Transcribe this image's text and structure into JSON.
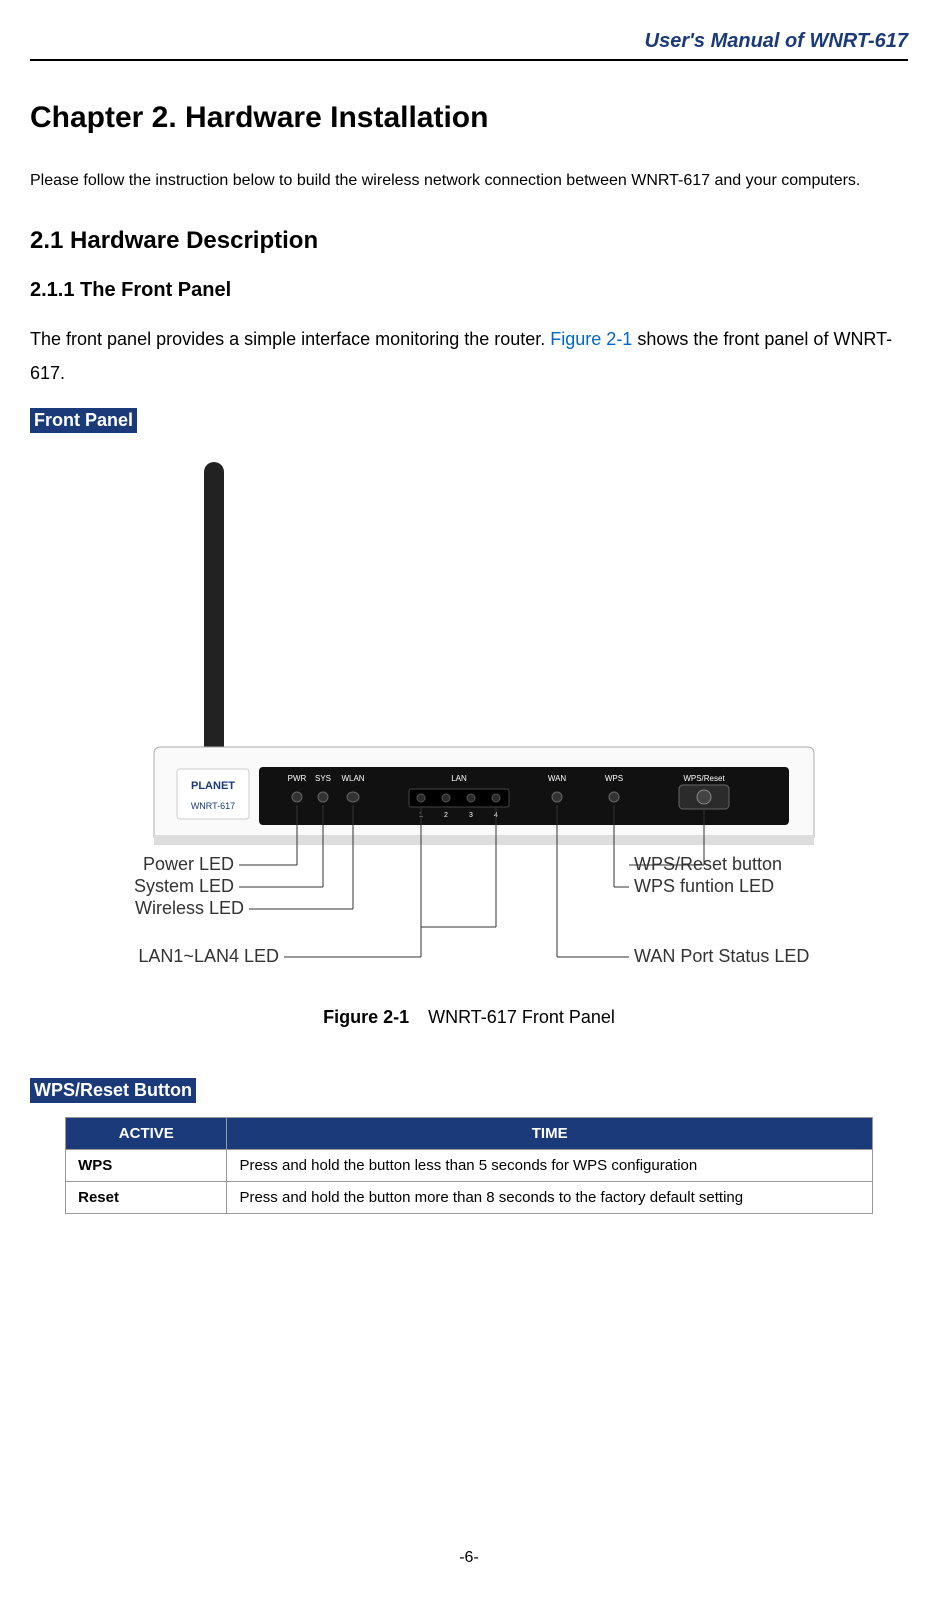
{
  "header": {
    "title": "User's Manual of WNRT-617"
  },
  "chapter": {
    "title": "Chapter 2.   Hardware Installation",
    "intro": "Please follow the instruction below to build the wireless network connection between WNRT-617 and your computers."
  },
  "section_2_1": {
    "title": "2.1  Hardware Description"
  },
  "section_2_1_1": {
    "title": "2.1.1  The Front Panel",
    "para_prefix": "The front panel provides a simple interface monitoring the router. ",
    "figure_ref": "Figure 2-1",
    "para_suffix": " shows the front panel of WNRT-617.",
    "front_panel_label": "Front Panel"
  },
  "figure": {
    "labels": {
      "power_led": "Power LED",
      "system_led": "System LED",
      "wireless_led": "Wireless LED",
      "lan_led": "LAN1~LAN4 LED",
      "wps_reset_btn": "WPS/Reset button",
      "wps_led": "WPS funtion LED",
      "wan_led": "WAN Port Status LED"
    },
    "device": {
      "brand": "PLANET",
      "model": "WNRT-617",
      "panel_labels": {
        "pwr": "PWR",
        "sys": "SYS",
        "wlan": "WLAN",
        "lan": "LAN",
        "wan": "WAN",
        "wps": "WPS",
        "wps_reset": "WPS/Reset",
        "lan1": "1",
        "lan2": "2",
        "lan3": "3",
        "lan4": "4"
      }
    },
    "caption_label": "Figure 2-1",
    "caption_text": "WNRT-617 Front Panel"
  },
  "wps_reset": {
    "heading": "WPS/Reset Button",
    "headers": {
      "active": "ACTIVE",
      "time": "TIME"
    },
    "rows": [
      {
        "active": "WPS",
        "time": "Press and hold the button less than 5 seconds for WPS configuration"
      },
      {
        "active": "Reset",
        "time": "Press and hold the button more than 8 seconds to the factory default setting"
      }
    ]
  },
  "page_number": "-6-"
}
